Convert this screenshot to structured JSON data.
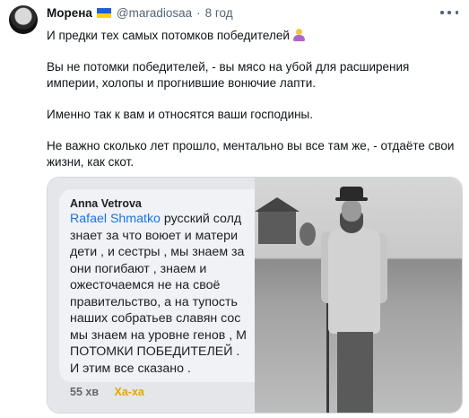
{
  "tweet": {
    "display_name": "Морена",
    "handle": "@maradiosaa",
    "separator": "·",
    "time": "8 год",
    "flag_colors": [
      "#1f5fd6",
      "#ffd400"
    ],
    "paragraphs": [
      "И предки тех самых потомков победителей",
      "Вы не потомки победителей, - вы мясо на убой для расширения империи, холопы и прогнившие вонючие лапти.",
      "Именно так к вам и относятся ваши господины.",
      "Не важно сколько лет прошло, ментально вы все там же, - отдаёте свои жизни, как скот."
    ],
    "emoji_icon": "woman-facepalming-icon"
  },
  "media": {
    "comment_author": "Anna Vetrova",
    "mention": "Rafael Shmatko",
    "first_line_rest": " русский солд",
    "lines": [
      "знает за что воюет и матери",
      "дети , и сестры , мы знаем за",
      "они погибают , знаем и",
      "ожесточаемся не на своё",
      "правительство, а на тупость",
      "наших собратьев славян сос",
      "мы знаем на уровне генов , М",
      "ПОТОМКИ ПОБЕДИТЕЛЕЙ .",
      "И этим все сказано ."
    ],
    "comment_time": "55 хв",
    "reaction": "Ха-ха",
    "photo_description_icon": "old-photo-peasant-image"
  }
}
